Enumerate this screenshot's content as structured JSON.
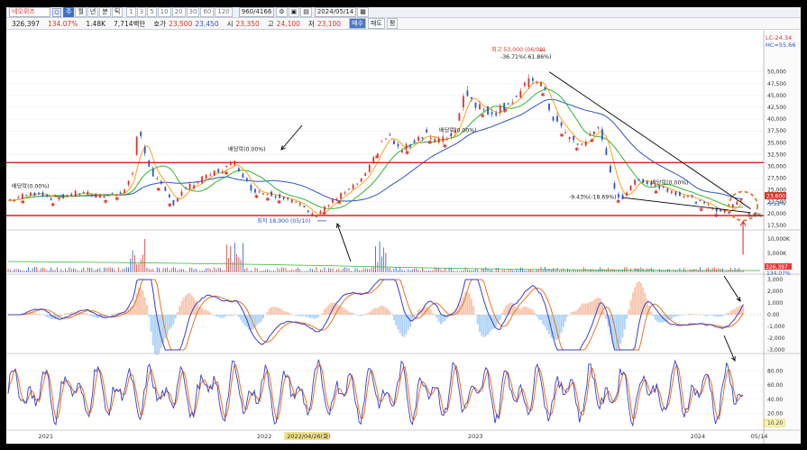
{
  "toolbar": {
    "stock_name": "네오위즈",
    "period_tabs": [
      "주",
      "월",
      "년",
      "분",
      "틱"
    ],
    "minute_tabs": [
      "1",
      "3",
      "5",
      "10",
      "20",
      "30",
      "60",
      "120"
    ],
    "count": "960",
    "total": "/4166",
    "date": "2024/05/14"
  },
  "quote": {
    "price": "326,397",
    "change_pct": "134.07%",
    "volume": "1.48K",
    "amount": "7,714백만",
    "ask_label": "호가",
    "ask": "23,500",
    "bid": "23,450",
    "open_label": "시",
    "open": "23,350",
    "high_label": "고",
    "high": "24,100",
    "low_label": "저",
    "low": "23,100",
    "buy_btn": "매수",
    "sell_btn": "매도",
    "eval_btn": "평"
  },
  "colors": {
    "up": "#d8342c",
    "down": "#2a56c6",
    "ma5": "#ff9f1a",
    "ma20": "#2eb82e",
    "ma60": "#2a56c6",
    "macd": "#3a3fc4",
    "signal": "#e8731f",
    "trendline": "#000000",
    "hline": "#e02020",
    "circle": "#e87722"
  },
  "chart_data": {
    "type": "line",
    "title": "",
    "xlabel": "",
    "ylabel": "",
    "x_ticks": [
      "2021",
      "2022",
      "2022/04/26(화)",
      "2023",
      "2024",
      "05/14"
    ],
    "price_axis": {
      "ylim": [
        17500,
        53000
      ],
      "ticks": [
        "50,000",
        "47,500",
        "45,000",
        "42,500",
        "40,000",
        "37,500",
        "35,000",
        "32,500",
        "30,000",
        "27,500",
        "25,000",
        "22,500",
        "20,000",
        "17,500"
      ],
      "current": "23,600",
      "current_pct": "-5.52%",
      "lc_label": "LC-24.34",
      "hc_label": "HC=55.66"
    },
    "volume_axis": {
      "ticks": [
        "10,000K",
        "5,000K"
      ],
      "current": "326,397",
      "current_pct": "134.07%"
    },
    "macd_axis": {
      "ylim": [
        -3000,
        3000
      ],
      "ticks": [
        "3,000",
        "2,000",
        "1,000",
        "0.00",
        "-1,000",
        "-2,000",
        "-3,000"
      ]
    },
    "stoch_axis": {
      "ylim": [
        0,
        100
      ],
      "ticks": [
        "80.00",
        "60.00",
        "40.00",
        "20.00"
      ],
      "current": "10.20"
    },
    "price_series": [
      {
        "t": 0,
        "p": 22800
      },
      {
        "t": 0.02,
        "p": 23800
      },
      {
        "t": 0.04,
        "p": 24500
      },
      {
        "t": 0.06,
        "p": 23200
      },
      {
        "t": 0.08,
        "p": 23900
      },
      {
        "t": 0.1,
        "p": 24600
      },
      {
        "t": 0.12,
        "p": 23600
      },
      {
        "t": 0.14,
        "p": 24100
      },
      {
        "t": 0.155,
        "p": 25200
      },
      {
        "t": 0.165,
        "p": 28500
      },
      {
        "t": 0.172,
        "p": 38200
      },
      {
        "t": 0.18,
        "p": 33500
      },
      {
        "t": 0.19,
        "p": 29000
      },
      {
        "t": 0.2,
        "p": 26500
      },
      {
        "t": 0.21,
        "p": 24000
      },
      {
        "t": 0.22,
        "p": 22200
      },
      {
        "t": 0.23,
        "p": 24800
      },
      {
        "t": 0.24,
        "p": 25600
      },
      {
        "t": 0.255,
        "p": 27000
      },
      {
        "t": 0.27,
        "p": 28500
      },
      {
        "t": 0.285,
        "p": 29400
      },
      {
        "t": 0.3,
        "p": 30800
      },
      {
        "t": 0.31,
        "p": 28800
      },
      {
        "t": 0.32,
        "p": 25500
      },
      {
        "t": 0.335,
        "p": 24600
      },
      {
        "t": 0.35,
        "p": 24200
      },
      {
        "t": 0.365,
        "p": 23600
      },
      {
        "t": 0.38,
        "p": 22400
      },
      {
        "t": 0.395,
        "p": 21000
      },
      {
        "t": 0.405,
        "p": 19500
      },
      {
        "t": 0.415,
        "p": 20800
      },
      {
        "t": 0.43,
        "p": 22500
      },
      {
        "t": 0.445,
        "p": 24300
      },
      {
        "t": 0.46,
        "p": 25800
      },
      {
        "t": 0.475,
        "p": 28200
      },
      {
        "t": 0.485,
        "p": 31500
      },
      {
        "t": 0.495,
        "p": 35200
      },
      {
        "t": 0.505,
        "p": 36500
      },
      {
        "t": 0.515,
        "p": 34000
      },
      {
        "t": 0.525,
        "p": 33400
      },
      {
        "t": 0.54,
        "p": 35800
      },
      {
        "t": 0.555,
        "p": 37200
      },
      {
        "t": 0.565,
        "p": 35500
      },
      {
        "t": 0.58,
        "p": 35600
      },
      {
        "t": 0.595,
        "p": 38200
      },
      {
        "t": 0.605,
        "p": 46500
      },
      {
        "t": 0.615,
        "p": 44200
      },
      {
        "t": 0.63,
        "p": 42000
      },
      {
        "t": 0.645,
        "p": 41500
      },
      {
        "t": 0.66,
        "p": 43200
      },
      {
        "t": 0.675,
        "p": 44800
      },
      {
        "t": 0.69,
        "p": 47500
      },
      {
        "t": 0.7,
        "p": 48800
      },
      {
        "t": 0.71,
        "p": 46500
      },
      {
        "t": 0.72,
        "p": 41000
      },
      {
        "t": 0.73,
        "p": 39000
      },
      {
        "t": 0.745,
        "p": 35800
      },
      {
        "t": 0.76,
        "p": 34500
      },
      {
        "t": 0.775,
        "p": 36800
      },
      {
        "t": 0.785,
        "p": 39000
      },
      {
        "t": 0.795,
        "p": 30500
      },
      {
        "t": 0.805,
        "p": 24500
      },
      {
        "t": 0.815,
        "p": 23200
      },
      {
        "t": 0.825,
        "p": 26000
      },
      {
        "t": 0.84,
        "p": 27300
      },
      {
        "t": 0.855,
        "p": 26200
      },
      {
        "t": 0.87,
        "p": 25400
      },
      {
        "t": 0.885,
        "p": 24600
      },
      {
        "t": 0.9,
        "p": 23700
      },
      {
        "t": 0.915,
        "p": 22500
      },
      {
        "t": 0.93,
        "p": 21500
      },
      {
        "t": 0.945,
        "p": 20600
      },
      {
        "t": 0.955,
        "p": 20200
      },
      {
        "t": 0.965,
        "p": 22600
      },
      {
        "t": 0.975,
        "p": 23600
      }
    ],
    "annotations": [
      {
        "text": "배당락(0.00%)"
      },
      {
        "text": "배당락(0.00%)"
      },
      {
        "text": "배당락(0.00%)"
      },
      {
        "text": "배당락(0.00%)"
      },
      {
        "text": "최고 53,000 (06/09)"
      },
      {
        "text": "-36.71%(-61.86%)"
      },
      {
        "text": "-9.43%(-18.69%)"
      },
      {
        "text": "최저 18,900 (05/10)"
      },
      {
        "text": "-5.6%"
      }
    ]
  }
}
